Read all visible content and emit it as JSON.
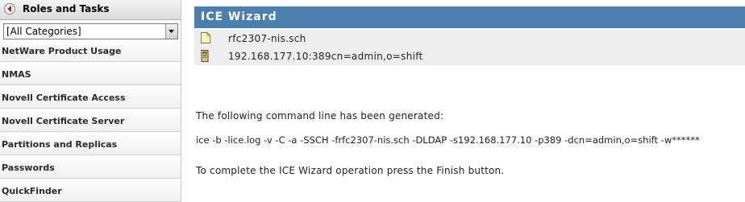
{
  "sidebar": {
    "title": "Roles and Tasks",
    "category_select": {
      "value": "[All Categories]"
    },
    "items": [
      {
        "label": "NetWare Product Usage"
      },
      {
        "label": "NMAS"
      },
      {
        "label": "Novell Certificate Access"
      },
      {
        "label": "Novell Certificate Server"
      },
      {
        "label": "Partitions and Replicas"
      },
      {
        "label": "Passwords"
      },
      {
        "label": "QuickFinder"
      }
    ]
  },
  "wizard": {
    "title": "ICE Wizard",
    "source_file": "rfc2307-nis.sch",
    "destination": "192.168.177.10:389cn=admin,o=shift",
    "generated_label": "The following command line has been generated:",
    "command_line": "ice -b -lice.log -v -C -a -SSCH -frfc2307-nis.sch -DLDAP -s192.168.177.10 -p389 -dcn=admin,o=shift -w******",
    "finish_instruction": "To complete the ICE Wizard operation press the Finish button."
  },
  "icons": {
    "collapse": "collapse-left-icon",
    "dropdown": "chevron-down-icon",
    "file": "document-icon",
    "server": "server-icon"
  },
  "colors": {
    "wizard_header": "#4b7fae",
    "row_background": "#eeeeee"
  }
}
